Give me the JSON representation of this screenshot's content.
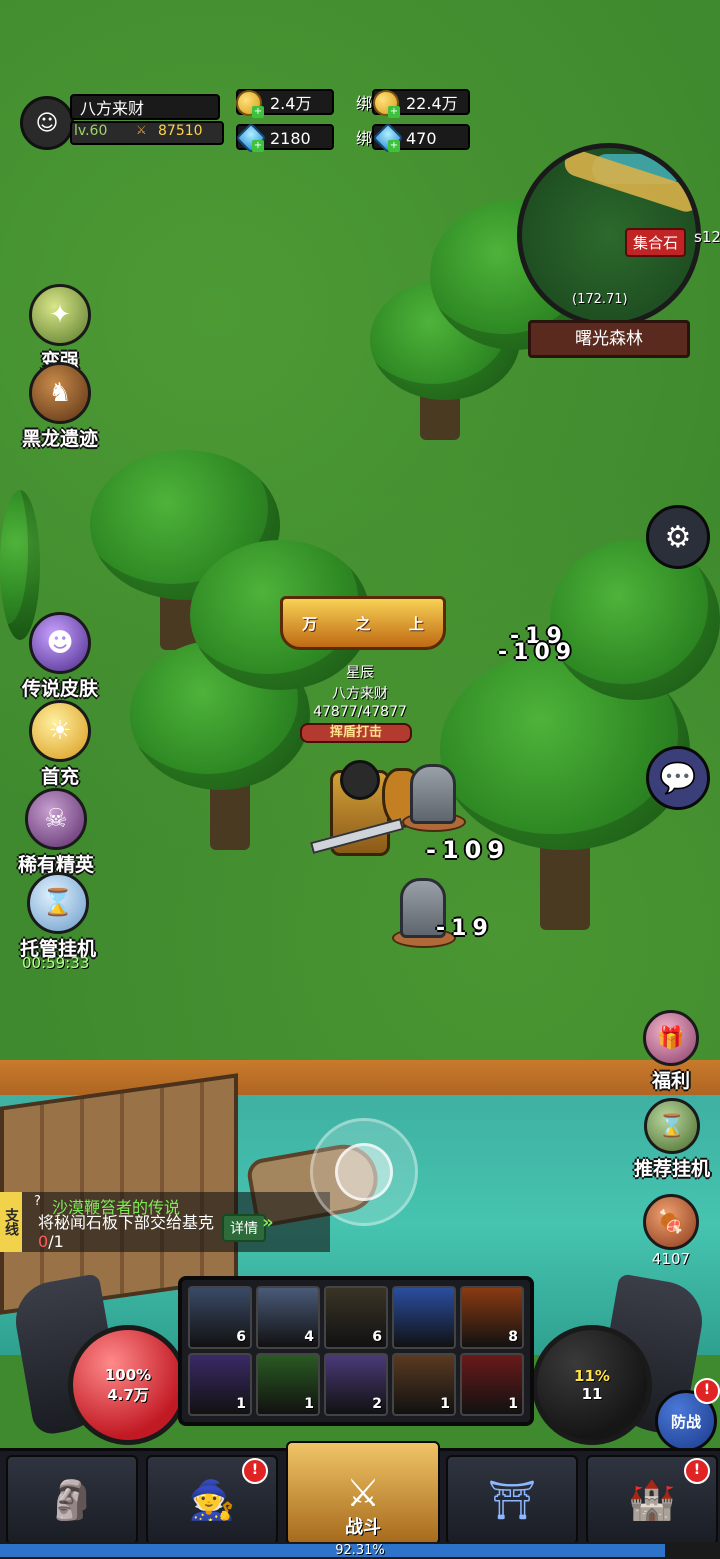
{
  "player": {
    "name": "八方来财",
    "level": "lv.60",
    "power": "87510"
  },
  "currency": {
    "gold": "2.4万",
    "bound_gold_prefix": "绑",
    "bound_gold": "22.4万",
    "diamond": "2180",
    "bound_diamond_prefix": "绑",
    "bound_diamond": "470"
  },
  "minimap": {
    "marker_label": "集合石",
    "server_fragment": "s12",
    "coords": "(172.71)",
    "map_name": "曙光森林"
  },
  "left_menu": [
    {
      "label": "变强",
      "icon": "power-up-icon"
    },
    {
      "label": "黑龙遗迹",
      "icon": "dragon-icon"
    },
    {
      "label": "传说皮肤",
      "icon": "skin-icon"
    },
    {
      "label": "首充",
      "icon": "first-recharge-icon"
    },
    {
      "label": "稀有精英",
      "icon": "elite-icon"
    },
    {
      "label": "托管挂机",
      "icon": "auto-idle-icon"
    }
  ],
  "idle_timer": "00:59:33",
  "hero": {
    "title_left": "万",
    "title_mid": "之",
    "title_right": "上",
    "guild": "星辰",
    "name": "八方来财",
    "hp": "47877/47877",
    "skill_cast": "挥盾打击"
  },
  "damage_numbers": [
    "-19",
    "-109",
    "-109",
    "-19"
  ],
  "quest": {
    "tag": "支线",
    "title": "沙漠鞭笞者的传说",
    "desc_main": "将秘闻石板下部交给基克",
    "progress_done": "0",
    "progress_total": "/1",
    "detail_label": "详情"
  },
  "right_menu": [
    {
      "label": "福利",
      "icon": "welfare-icon"
    },
    {
      "label": "推荐挂机",
      "icon": "recommend-idle-icon"
    }
  ],
  "meat_count": "4107",
  "orbs": {
    "hp_pct": "100%",
    "hp_value": "4.7万",
    "mp_pct": "11%",
    "mp_value": "11"
  },
  "skills": [
    {
      "count": "6",
      "color": "#3a4a66"
    },
    {
      "count": "4",
      "color": "#4a5a78"
    },
    {
      "count": "6",
      "color": "#3a3426"
    },
    {
      "count": "",
      "color": "#2a4ea0"
    },
    {
      "count": "8",
      "color": "#8a3a12"
    },
    {
      "count": "1",
      "color": "#3a2a66"
    },
    {
      "count": "1",
      "color": "#2a5a22"
    },
    {
      "count": "2",
      "color": "#4a3a78"
    },
    {
      "count": "1",
      "color": "#5a3a22"
    },
    {
      "count": "1",
      "color": "#6a1a1a"
    }
  ],
  "defend_label": "防战",
  "nav": {
    "items": [
      {
        "icon": "stone-icon"
      },
      {
        "icon": "mage-icon"
      },
      {
        "icon": "battle-icon",
        "label": "战斗"
      },
      {
        "icon": "gate-icon"
      },
      {
        "icon": "castle-icon"
      }
    ]
  },
  "xp": {
    "percent_text": "92.31%",
    "fraction": 0.9231
  },
  "alert_mark": "!"
}
